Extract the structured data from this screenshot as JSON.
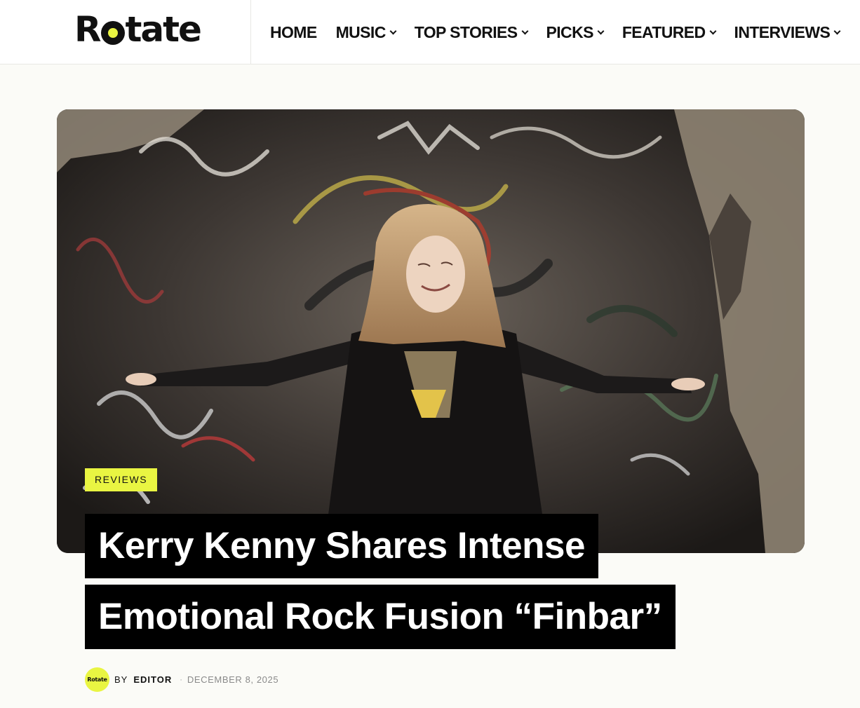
{
  "site": {
    "logo_text_before": "R",
    "logo_text_after": "tate",
    "logo_accent_color": "#e9f542"
  },
  "nav": {
    "items": [
      {
        "label": "HOME",
        "has_dropdown": false
      },
      {
        "label": "MUSIC",
        "has_dropdown": true
      },
      {
        "label": "TOP STORIES",
        "has_dropdown": true
      },
      {
        "label": "PICKS",
        "has_dropdown": true
      },
      {
        "label": "FEATURED",
        "has_dropdown": true
      },
      {
        "label": "INTERVIEWS",
        "has_dropdown": true
      }
    ]
  },
  "article": {
    "category": "REVIEWS",
    "title_line_1": "Kerry Kenny Shares Intense",
    "title_line_2": "Emotional Rock Fusion “Finbar”",
    "by_label": "BY",
    "author": "EDITOR",
    "separator": "·",
    "date": "DECEMBER 8, 2025",
    "avatar_text": "Rotate"
  },
  "colors": {
    "accent": "#e9f542",
    "title_bg": "#000000",
    "title_text": "#ffffff",
    "page_bg": "#fbfbf7"
  }
}
